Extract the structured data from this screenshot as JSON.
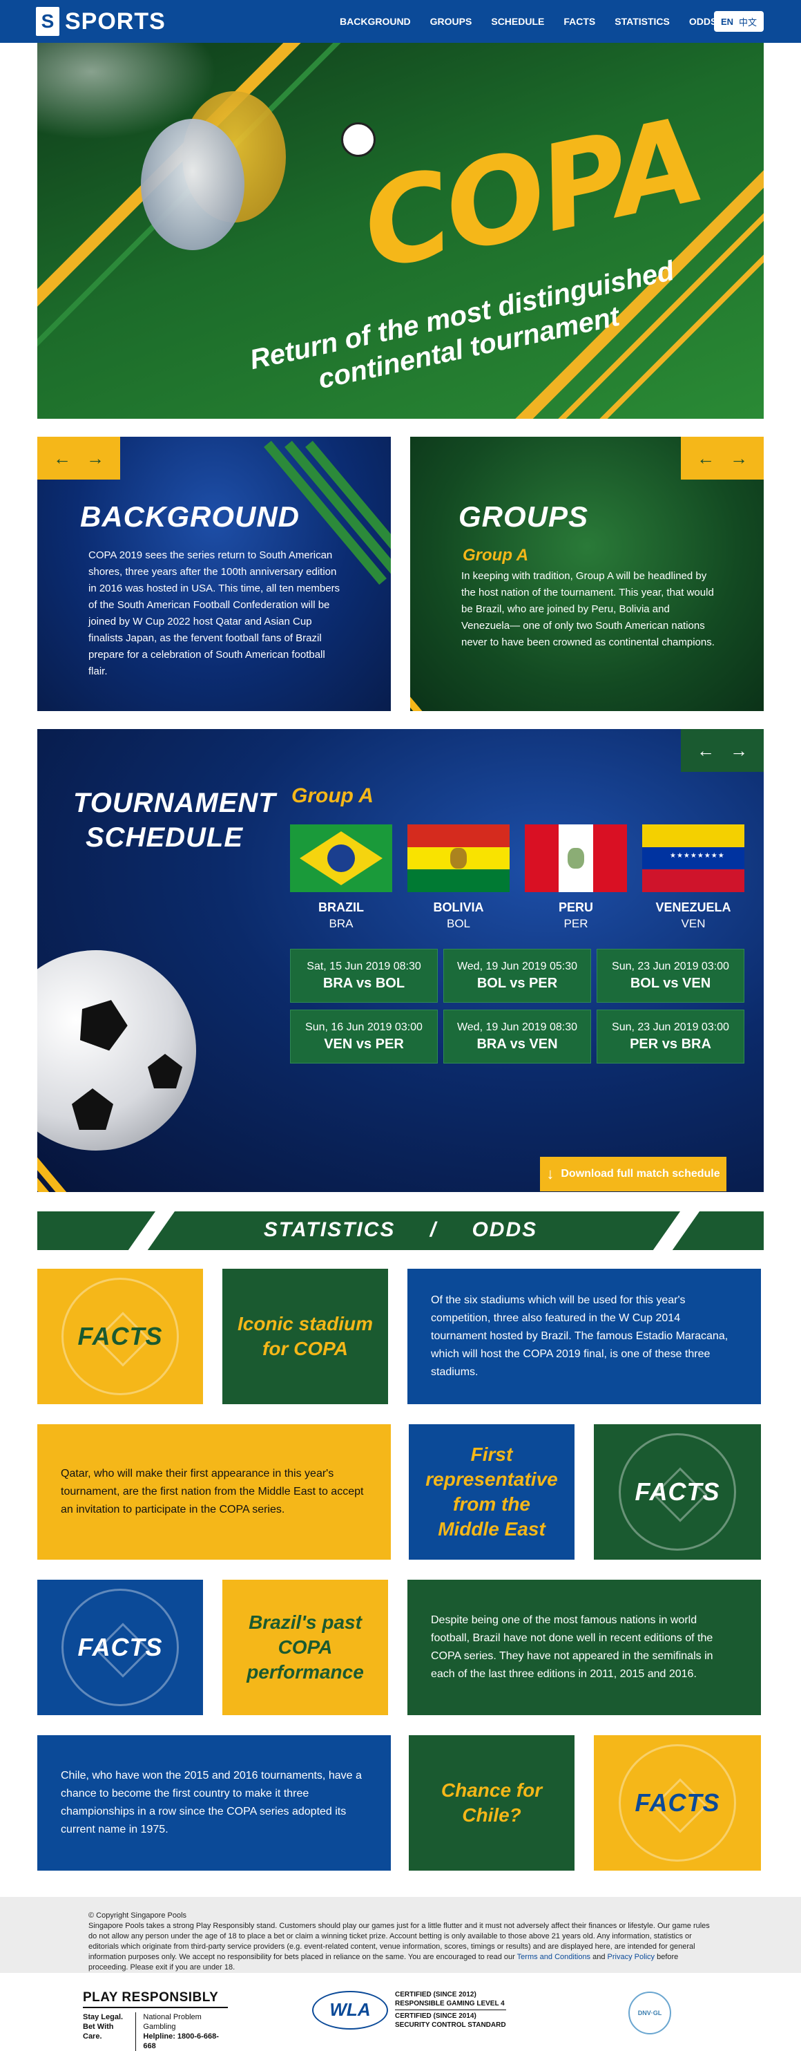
{
  "nav": {
    "logo_mark": "S",
    "logo_text": "SPORTS",
    "items": [
      "BACKGROUND",
      "GROUPS",
      "SCHEDULE",
      "FACTS",
      "STATISTICS",
      "ODDS"
    ],
    "lang_en": "EN",
    "lang_zh": "中文"
  },
  "hero": {
    "title": "COPA",
    "subtitle": "Return of the most distinguished continental tournament"
  },
  "background": {
    "title": "BACKGROUND",
    "text": "COPA 2019 sees the series return to South American shores, three years after the 100th anniversary edition in 2016 was hosted in USA. This time, all ten members of the South American Football Confederation will be joined by W Cup 2022 host Qatar and Asian Cup finalists Japan, as the fervent football fans of Brazil prepare for a celebration of South American football flair."
  },
  "groups": {
    "title": "GROUPS",
    "subtitle": "Group A",
    "text": "In keeping with tradition, Group A will be headlined by the host nation of the tournament. This year, that would be Brazil, who are joined by Peru, Bolivia and Venezuela— one of only two South American nations never to have been crowned as continental champions."
  },
  "schedule": {
    "title_line1": "TOURNAMENT",
    "title_line2": "SCHEDULE",
    "group": "Group A",
    "teams": [
      {
        "name": "BRAZIL",
        "code": "BRA"
      },
      {
        "name": "BOLIVIA",
        "code": "BOL"
      },
      {
        "name": "PERU",
        "code": "PER"
      },
      {
        "name": "VENEZUELA",
        "code": "VEN"
      }
    ],
    "matches": [
      {
        "date": "Sat, 15 Jun 2019 08:30",
        "match": "BRA vs BOL"
      },
      {
        "date": "Wed, 19 Jun 2019 05:30",
        "match": "BOL vs PER"
      },
      {
        "date": "Sun, 23 Jun 2019 03:00",
        "match": "BOL vs VEN"
      },
      {
        "date": "Sun, 16 Jun 2019 03:00",
        "match": "VEN vs PER"
      },
      {
        "date": "Wed, 19 Jun 2019 08:30",
        "match": "BRA vs VEN"
      },
      {
        "date": "Sun, 23 Jun 2019 03:00",
        "match": "PER vs BRA"
      }
    ],
    "download": "Download full match schedule"
  },
  "stats_bar": {
    "left": "STATISTICS",
    "sep": "/",
    "right": "ODDS"
  },
  "facts": {
    "label": "FACTS",
    "h1": "Iconic stadium for COPA",
    "t1": "Of the six stadiums which will be used for this year's competition, three also featured in the W Cup 2014 tournament hosted by Brazil. The famous Estadio Maracana, which will host the COPA 2019 final, is one of these three stadiums.",
    "h2": "First representative from the Middle East",
    "t2": "Qatar, who will make their first appearance in this year's tournament, are the first nation from the Middle East to accept an invitation to participate in the COPA series.",
    "h3": "Brazil's past COPA performance",
    "t3": "Despite being one of the most famous nations in world football, Brazil have not done well in recent editions of the COPA series. They have not appeared in the semifinals in each of the last three editions in 2011, 2015 and 2016.",
    "h4": "Chance for Chile?",
    "t4": "Chile, who have won the 2015 and 2016 tournaments, have a chance to become the first country to make it three championships in a row since the COPA series adopted its current name in 1975."
  },
  "footer": {
    "copyright": "© Copyright Singapore Pools",
    "text1": "Singapore Pools takes a strong Play Responsibly stand. Customers should play our games just for a little flutter and it must not adversely affect their finances or lifestyle. Our game rules do not allow any person under the age of 18 to place a bet or claim a winning ticket prize. Account betting is only available to those above 21 years old. Any information, statistics or editorials which originate from third-party service providers (e.g. event-related content, venue information, scores, timings or results) and are displayed here, are intended for general information purposes only. We accept no responsibility for bets placed in reliance on the same. You are encouraged to read our",
    "tc": "Terms and Conditions",
    "and": "and",
    "pp": "Privacy Policy",
    "text2": "before proceeding. Please exit if you are under 18.",
    "pr_title": "PLAY RESPONSIBLY",
    "pr_l1": "Stay Legal.",
    "pr_l2": "Bet With Care.",
    "pr_r1": "National Problem Gambling",
    "pr_r2": "Helpline: 1800-6-668-668",
    "wla": "WLA",
    "cert1a": "CERTIFIED (SINCE 2012)",
    "cert1b": "RESPONSIBLE GAMING LEVEL 4",
    "cert2a": "CERTIFIED (SINCE 2014)",
    "cert2b": "SECURITY CONTROL STANDARD",
    "seal": "DNV·GL"
  }
}
